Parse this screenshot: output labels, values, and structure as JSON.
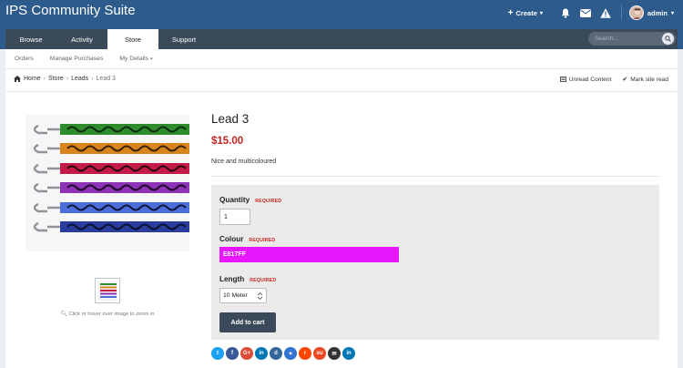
{
  "header": {
    "site_title": "IPS Community Suite",
    "create_label": "Create",
    "user_name": "admin"
  },
  "nav": {
    "tabs": [
      {
        "label": "Browse"
      },
      {
        "label": "Activity"
      },
      {
        "label": "Store",
        "active": true
      },
      {
        "label": "Support"
      }
    ],
    "search_placeholder": "Search..."
  },
  "subnav": {
    "items": [
      {
        "label": "Orders"
      },
      {
        "label": "Manage Purchases"
      },
      {
        "label": "My Details"
      }
    ]
  },
  "breadcrumb": {
    "items": [
      "Home",
      "Store",
      "Leads",
      "Lead 3"
    ],
    "actions": {
      "unread": "Unread Content",
      "mark_read": "Mark site read"
    }
  },
  "product": {
    "title": "Lead 3",
    "price": "$15.00",
    "description": "Nice and multicoloured",
    "zoom_hint": "Click or hover over image to zoom in"
  },
  "form": {
    "required_label": "REQUIRED",
    "quantity_label": "Quantity",
    "quantity_value": "1",
    "colour_label": "Colour",
    "colour_value": "E817FF",
    "length_label": "Length",
    "length_value": "10 Meter",
    "add_to_cart": "Add to cart"
  },
  "share": {
    "buttons": [
      {
        "name": "twitter",
        "glyph": "t",
        "color": "#1da1f2"
      },
      {
        "name": "facebook",
        "glyph": "f",
        "color": "#3b5998"
      },
      {
        "name": "google-plus",
        "glyph": "G+",
        "color": "#dd4b39"
      },
      {
        "name": "linkedin",
        "glyph": "in",
        "color": "#0077b5"
      },
      {
        "name": "digg",
        "glyph": "d",
        "color": "#336699"
      },
      {
        "name": "delicious",
        "glyph": "✦",
        "color": "#3274d1"
      },
      {
        "name": "reddit",
        "glyph": "r",
        "color": "#ff4500"
      },
      {
        "name": "stumbleupon",
        "glyph": "su",
        "color": "#eb4924"
      },
      {
        "name": "email",
        "glyph": "✉",
        "color": "#333333"
      },
      {
        "name": "linkedin-2",
        "glyph": "in",
        "color": "#0077b5"
      }
    ]
  },
  "colors": {
    "brand": "#2d5b8c",
    "nav_dark": "#3b4a5a",
    "price_red": "#c5241e",
    "swatch": "#e817ff"
  }
}
